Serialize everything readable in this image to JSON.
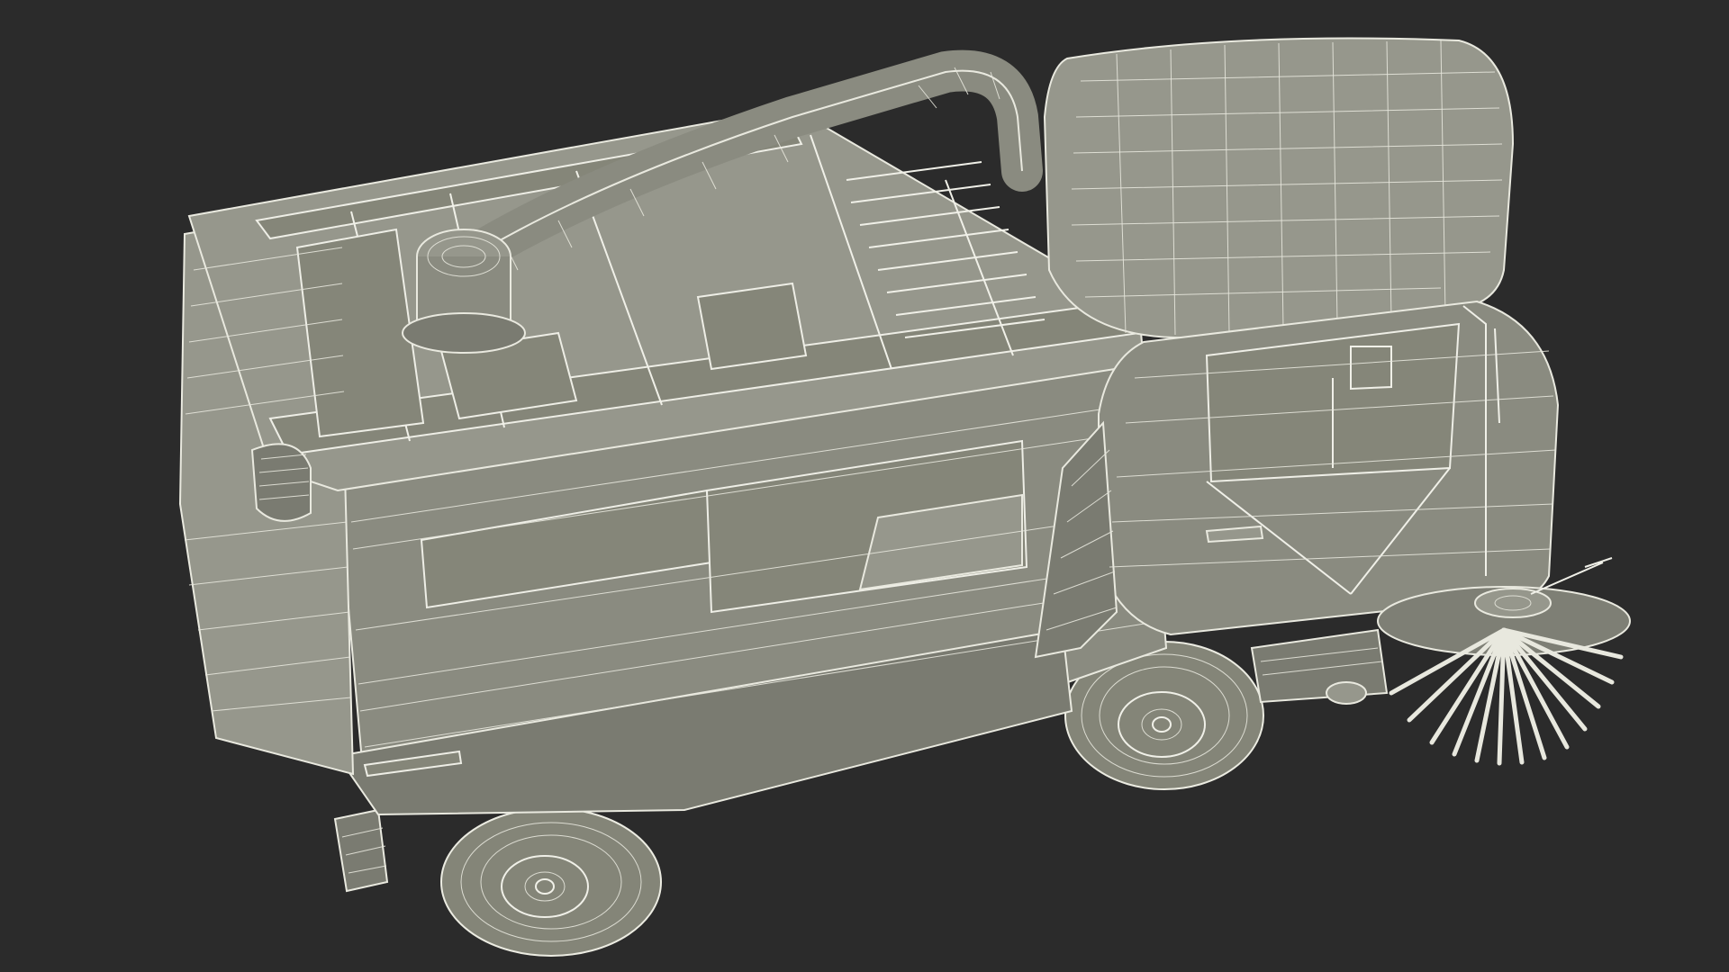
{
  "scene": {
    "subject": "",
    "colors": {
      "background": "#2b2b2b",
      "body": "#8a8b80",
      "wireframe": "#e9e9df"
    }
  }
}
